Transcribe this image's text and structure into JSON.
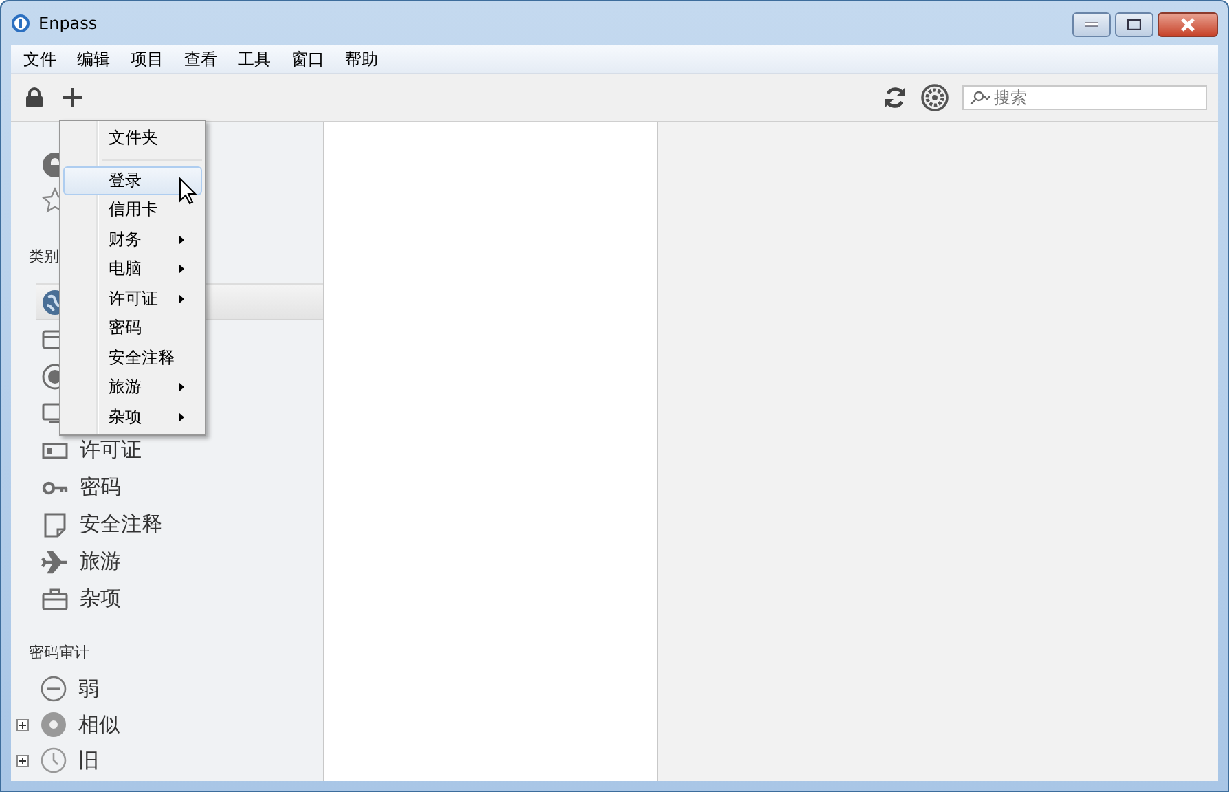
{
  "window": {
    "title": "Enpass"
  },
  "menubar": [
    "文件",
    "编辑",
    "项目",
    "查看",
    "工具",
    "窗口",
    "帮助"
  ],
  "search": {
    "placeholder": "搜索"
  },
  "sidebar": {
    "top_items": [
      {
        "kind": "all"
      },
      {
        "kind": "favorites"
      }
    ],
    "categories_header": "类别",
    "categories": [
      {
        "kind": "login",
        "selected": true
      },
      {
        "kind": "card",
        "selected": false
      },
      {
        "kind": "finance",
        "selected": false
      },
      {
        "kind": "computer",
        "selected": false
      },
      {
        "kind": "license",
        "label": "许可证",
        "selected": false
      },
      {
        "kind": "password",
        "label": "密码",
        "selected": false
      },
      {
        "kind": "note",
        "label": "安全注释",
        "selected": false
      },
      {
        "kind": "travel",
        "label": "旅游",
        "selected": false
      },
      {
        "kind": "misc",
        "label": "杂项",
        "selected": false
      }
    ],
    "audit_header": "密码审计",
    "audit": [
      {
        "kind": "weak",
        "label": "弱",
        "expandable": false
      },
      {
        "kind": "similar",
        "label": "相似",
        "expandable": true
      },
      {
        "kind": "old",
        "label": "旧",
        "expandable": true
      }
    ]
  },
  "add_menu": {
    "items": [
      {
        "kind": "item",
        "label": "文件夹",
        "submenu": false,
        "selected": false
      },
      {
        "kind": "separator"
      },
      {
        "kind": "item",
        "label": "登录",
        "submenu": false,
        "selected": true
      },
      {
        "kind": "item",
        "label": "信用卡",
        "submenu": false,
        "selected": false
      },
      {
        "kind": "item",
        "label": "财务",
        "submenu": true,
        "selected": false
      },
      {
        "kind": "item",
        "label": "电脑",
        "submenu": true,
        "selected": false
      },
      {
        "kind": "item",
        "label": "许可证",
        "submenu": true,
        "selected": false
      },
      {
        "kind": "item",
        "label": "密码",
        "submenu": false,
        "selected": false
      },
      {
        "kind": "item",
        "label": "安全注释",
        "submenu": false,
        "selected": false
      },
      {
        "kind": "item",
        "label": "旅游",
        "submenu": true,
        "selected": false
      },
      {
        "kind": "item",
        "label": "杂项",
        "submenu": true,
        "selected": false
      }
    ]
  }
}
